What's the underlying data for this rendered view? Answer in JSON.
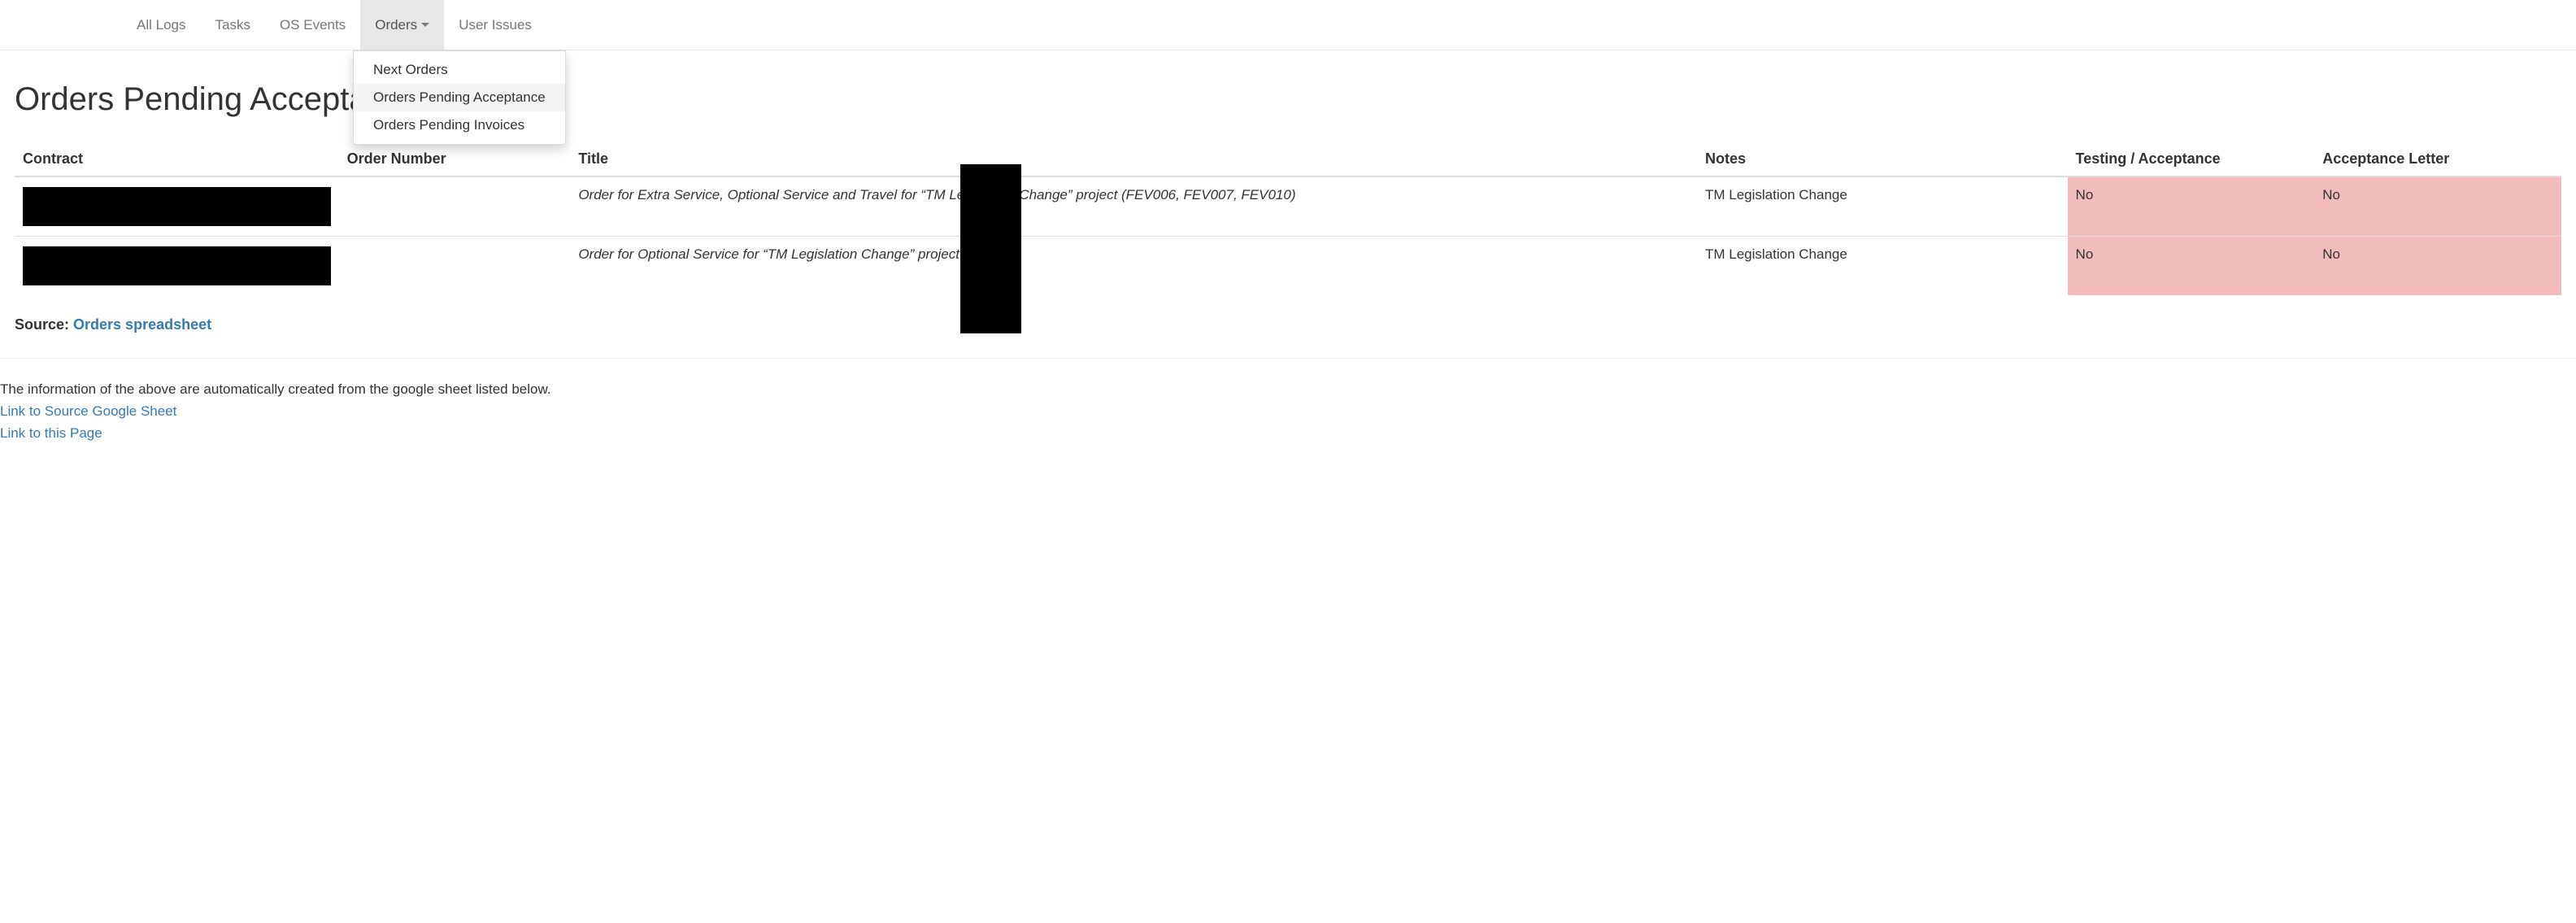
{
  "nav": {
    "items": [
      {
        "label": "All Logs"
      },
      {
        "label": "Tasks"
      },
      {
        "label": "OS Events"
      },
      {
        "label": "Orders",
        "active": true,
        "hasDropdown": true
      },
      {
        "label": "User Issues"
      }
    ],
    "dropdown": {
      "items": [
        {
          "label": "Next Orders",
          "highlighted": false
        },
        {
          "label": "Orders Pending Acceptance",
          "highlighted": true
        },
        {
          "label": "Orders Pending Invoices",
          "highlighted": false
        }
      ]
    }
  },
  "page": {
    "title": "Orders Pending Acceptance"
  },
  "table": {
    "headers": {
      "contract": "Contract",
      "order_number": "Order Number",
      "title": "Title",
      "notes": "Notes",
      "redacted": "",
      "testing": "Testing / Acceptance",
      "letter": "Acceptance Letter"
    },
    "rows": [
      {
        "contract": "",
        "order_number": "",
        "title": "Order for Extra Service, Optional Service and Travel for “TM Legislation Change” project (FEV006, FEV007, FEV010)",
        "notes": "TM Legislation Change",
        "redacted": "",
        "testing": "No",
        "letter": "No"
      },
      {
        "contract": "",
        "order_number": "",
        "title": "Order for Optional Service for “TM Legislation Change” project (FEV011)",
        "notes": "TM Legislation Change",
        "redacted": "",
        "testing": "No",
        "letter": "No"
      }
    ]
  },
  "source": {
    "prefix": "Source: ",
    "link_text": "Orders spreadsheet"
  },
  "footer": {
    "info_text": "The information of the above are automatically created from the google sheet listed below.",
    "link_source": "Link to Source Google Sheet",
    "link_page": "Link to this Page"
  }
}
